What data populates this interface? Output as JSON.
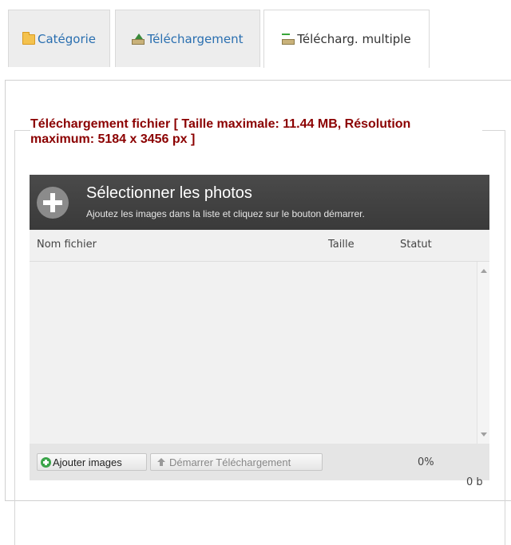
{
  "tabs": [
    {
      "label": "Catégorie",
      "icon": "folder-icon",
      "active": false
    },
    {
      "label": "Téléchargement",
      "icon": "upload-icon",
      "active": false
    },
    {
      "label": "Télécharg. multiple",
      "icon": "multi-upload-icon",
      "active": true
    }
  ],
  "fieldset": {
    "legend": "Téléchargement fichier [ Taille maximale: 11.44 MB, Résolution maximum: 5184 x 3456 px ]"
  },
  "uploader": {
    "title": "Sélectionner les photos",
    "subtitle": "Ajoutez les images dans la liste et cliquez sur le bouton démarrer.",
    "columns": {
      "filename": "Nom fichier",
      "size": "Taille",
      "status": "Statut"
    },
    "add_button": "Ajouter images",
    "start_button": "Démarrer Téléchargement",
    "percent": "0%",
    "total_size": "0 b"
  },
  "colors": {
    "legend": "#8b0000",
    "tab_link": "#2a6fb0",
    "header_bg": "#3f3f3f"
  }
}
